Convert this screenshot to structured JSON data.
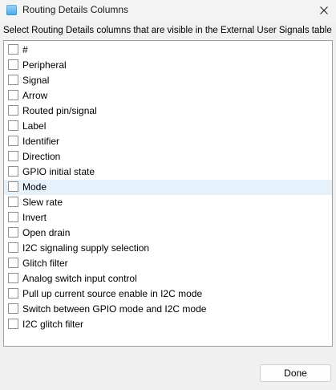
{
  "window": {
    "title": "Routing Details Columns",
    "close_icon": "close-icon",
    "app_icon": "window-icon"
  },
  "instruction": "Select Routing Details columns that are visible in the External User Signals table",
  "columns": [
    {
      "label": "#",
      "checked": false,
      "highlighted": false
    },
    {
      "label": "Peripheral",
      "checked": false,
      "highlighted": false
    },
    {
      "label": "Signal",
      "checked": false,
      "highlighted": false
    },
    {
      "label": "Arrow",
      "checked": false,
      "highlighted": false
    },
    {
      "label": "Routed pin/signal",
      "checked": false,
      "highlighted": false
    },
    {
      "label": "Label",
      "checked": false,
      "highlighted": false
    },
    {
      "label": "Identifier",
      "checked": false,
      "highlighted": false
    },
    {
      "label": "Direction",
      "checked": false,
      "highlighted": false
    },
    {
      "label": "GPIO initial state",
      "checked": false,
      "highlighted": false
    },
    {
      "label": "Mode",
      "checked": false,
      "highlighted": true
    },
    {
      "label": "Slew rate",
      "checked": false,
      "highlighted": false
    },
    {
      "label": "Invert",
      "checked": false,
      "highlighted": false
    },
    {
      "label": "Open drain",
      "checked": false,
      "highlighted": false
    },
    {
      "label": "I2C signaling supply selection",
      "checked": false,
      "highlighted": false
    },
    {
      "label": "Glitch filter",
      "checked": false,
      "highlighted": false
    },
    {
      "label": "Analog switch input control",
      "checked": false,
      "highlighted": false
    },
    {
      "label": "Pull up current source enable in I2C mode",
      "checked": false,
      "highlighted": false
    },
    {
      "label": "Switch between GPIO mode and I2C mode",
      "checked": false,
      "highlighted": false
    },
    {
      "label": "I2C glitch filter",
      "checked": false,
      "highlighted": false
    }
  ],
  "buttons": {
    "done_label": "Done"
  },
  "colors": {
    "highlight": "#e5f1fb",
    "window_background": "#f0f0f0",
    "list_background": "#ffffff"
  }
}
